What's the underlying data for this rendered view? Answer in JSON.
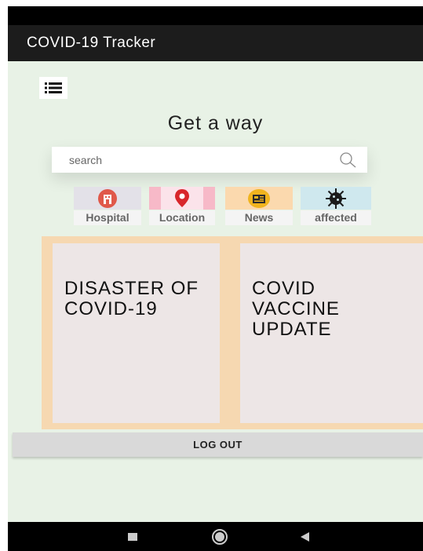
{
  "app": {
    "title": "COVID-19 Tracker"
  },
  "main": {
    "heading": "Get a way",
    "search": {
      "placeholder": "search",
      "value": ""
    }
  },
  "categories": [
    {
      "label": "Hospital",
      "icon": "hospital-icon"
    },
    {
      "label": "Location",
      "icon": "location-pin-icon"
    },
    {
      "label": "News",
      "icon": "news-icon"
    },
    {
      "label": "affected",
      "icon": "virus-icon"
    }
  ],
  "cards": [
    {
      "title": "DISASTER OF COVID-19"
    },
    {
      "title": "COVID VACCINE UPDATE"
    }
  ],
  "actions": {
    "logout_label": "LOG OUT"
  },
  "colors": {
    "app_bar": "#1c1c1c",
    "background": "#e8f2e6",
    "card_frame": "#f6d8b1",
    "card": "#ede6e6"
  }
}
